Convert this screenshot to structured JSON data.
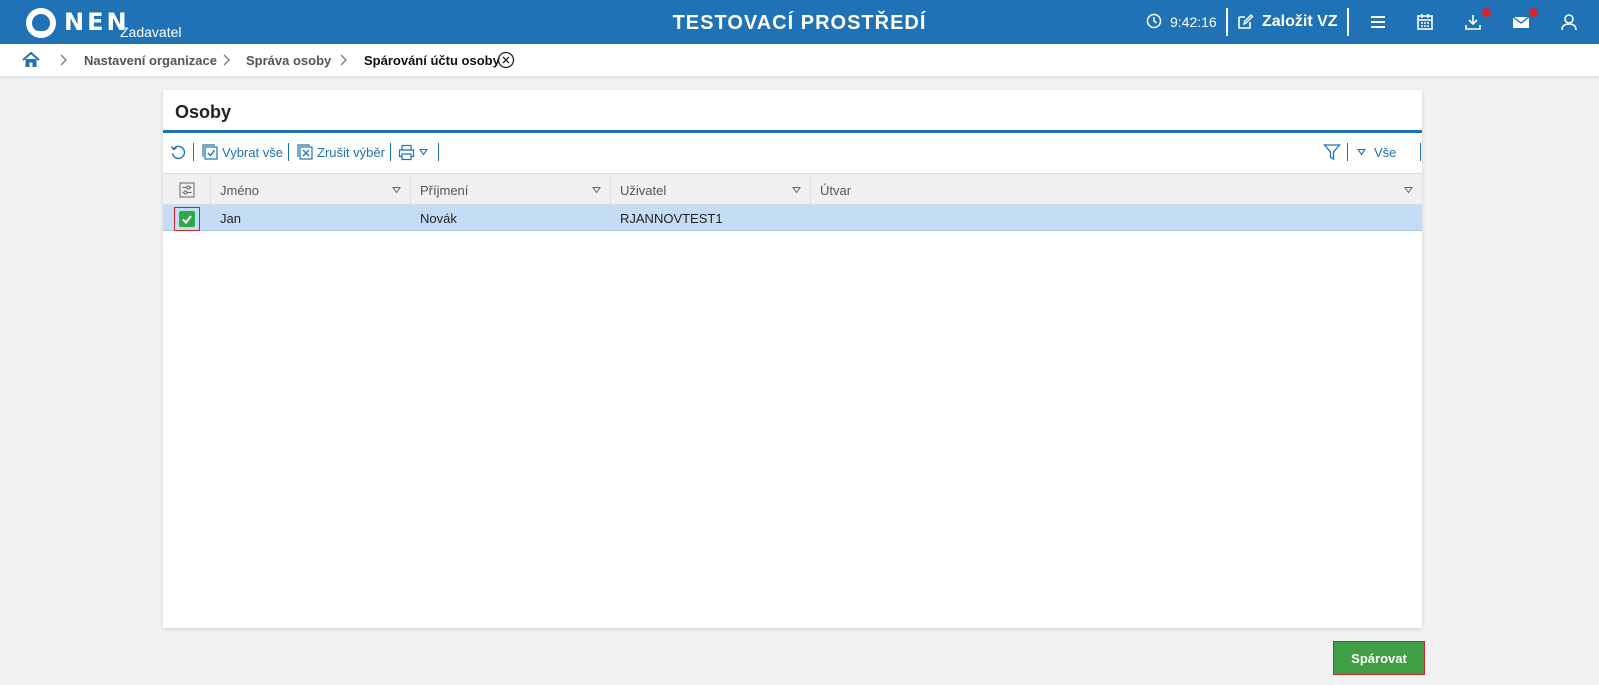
{
  "header": {
    "logo_text": "NEN",
    "logo_subtitle": "Zadavatel",
    "environment_title": "TESTOVACÍ PROSTŘEDÍ",
    "clock_time": "9:42:16",
    "new_tender_label": "Založit VZ",
    "icons": [
      "clock-icon",
      "edit-icon",
      "menu-icon",
      "calendar-icon",
      "download-icon",
      "mail-icon",
      "user-icon"
    ],
    "notification_color": "#d8232a"
  },
  "breadcrumb": {
    "items": [
      {
        "label": "Nastavení organizace"
      },
      {
        "label": "Správa osoby"
      },
      {
        "label": "Spárování účtu osoby"
      }
    ]
  },
  "panel": {
    "title": "Osoby",
    "toolbar": {
      "select_all_label": "Vybrat vše",
      "clear_selection_label": "Zrušit výběr",
      "filter_all_label": "Vše"
    },
    "table": {
      "columns": [
        {
          "label": "Jméno"
        },
        {
          "label": "Příjmení"
        },
        {
          "label": "Uživatel"
        },
        {
          "label": "Útvar"
        }
      ],
      "rows": [
        {
          "selected": true,
          "cells": [
            "Jan",
            "Novák",
            "RJANNOVTEST1",
            ""
          ]
        }
      ]
    }
  },
  "actions": {
    "pair_label": "Spárovat"
  },
  "colors": {
    "brand_blue": "#1f72b5",
    "row_selected": "#c5dcf5",
    "checkbox_green": "#2ea84b",
    "button_green": "#3f9f45"
  }
}
